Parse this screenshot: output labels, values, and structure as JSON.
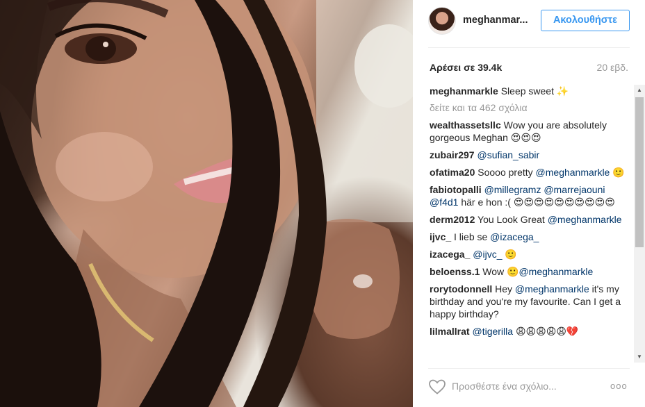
{
  "header": {
    "username": "meghanmar...",
    "follow_label": "Ακολουθήστε"
  },
  "stats": {
    "likes": "Αρέσει σε 39.4k",
    "time": "20 εβδ."
  },
  "caption": {
    "user": "meghanmarkle",
    "text": " Sleep sweet ✨"
  },
  "view_all": "δείτε και τα 462 σχόλια",
  "comments": [
    {
      "user": "wealthassetsllc",
      "parts": [
        {
          "t": " Wow you are absolutely gorgeous Meghan 😍😍😍",
          "m": false
        }
      ]
    },
    {
      "user": "zubair297",
      "parts": [
        {
          "t": " ",
          "m": false
        },
        {
          "t": "@sufian_sabir",
          "m": true
        }
      ]
    },
    {
      "user": "ofatima20",
      "parts": [
        {
          "t": " Soooo pretty ",
          "m": false
        },
        {
          "t": "@meghanmarkle",
          "m": true
        },
        {
          "t": " 🙂",
          "m": false
        }
      ]
    },
    {
      "user": "fabiotopalli",
      "parts": [
        {
          "t": " ",
          "m": false
        },
        {
          "t": "@millegramz",
          "m": true
        },
        {
          "t": " ",
          "m": false
        },
        {
          "t": "@marrejaouni",
          "m": true
        },
        {
          "t": " ",
          "m": false
        },
        {
          "t": "@f4d1",
          "m": true
        },
        {
          "t": " här e hon :( 😍😍😍😍😍😍😍😍😍😍",
          "m": false
        }
      ]
    },
    {
      "user": "derm2012",
      "parts": [
        {
          "t": " You Look Great ",
          "m": false
        },
        {
          "t": "@meghanmarkle",
          "m": true
        }
      ]
    },
    {
      "user": "ijvc_",
      "parts": [
        {
          "t": " I lieb se ",
          "m": false
        },
        {
          "t": "@izacega_",
          "m": true
        }
      ]
    },
    {
      "user": "izacega_",
      "parts": [
        {
          "t": " ",
          "m": false
        },
        {
          "t": "@ijvc_",
          "m": true
        },
        {
          "t": " 🙂",
          "m": false
        }
      ]
    },
    {
      "user": "beloenss.1",
      "parts": [
        {
          "t": " Wow 🙂",
          "m": false
        },
        {
          "t": "@meghanmarkle",
          "m": true
        }
      ]
    },
    {
      "user": "rorytodonnell",
      "parts": [
        {
          "t": " Hey ",
          "m": false
        },
        {
          "t": "@meghanmarkle",
          "m": true
        },
        {
          "t": " it's my birthday and you're my favourite. Can I get a happy birthday?",
          "m": false
        }
      ]
    },
    {
      "user": "lilmallrat",
      "parts": [
        {
          "t": " ",
          "m": false
        },
        {
          "t": "@tigerilla",
          "m": true
        },
        {
          "t": " 😩😩😩😩😩💔",
          "m": false
        }
      ]
    }
  ],
  "footer": {
    "comment_placeholder": "Προσθέστε ένα σχόλιο...",
    "more_label": "ooo"
  },
  "icons": {
    "heart": "heart-outline-icon",
    "more": "more-options-icon"
  },
  "colors": {
    "accent": "#3897f0",
    "mention": "#003569",
    "muted": "#999999"
  }
}
